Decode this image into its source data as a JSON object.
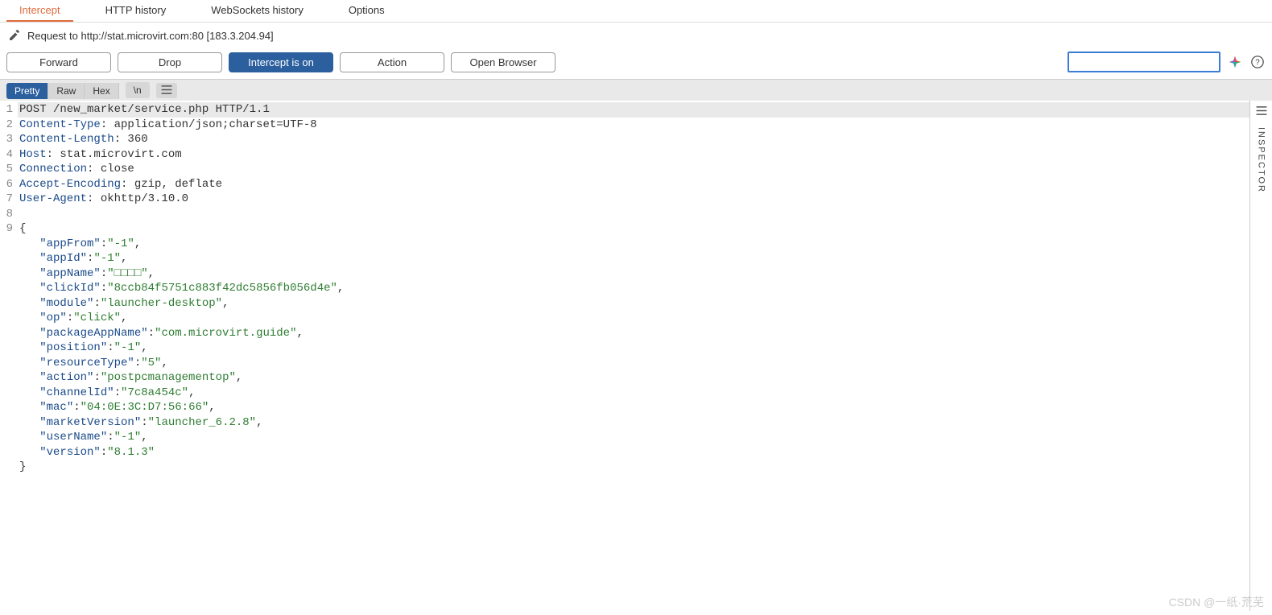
{
  "tabs": [
    "Intercept",
    "HTTP history",
    "WebSockets history",
    "Options"
  ],
  "activeTab": 0,
  "requestLine": "Request to http://stat.microvirt.com:80  [183.3.204.94]",
  "buttons": {
    "forward": "Forward",
    "drop": "Drop",
    "intercept": "Intercept is on",
    "action": "Action",
    "open": "Open Browser"
  },
  "searchPlaceholder": "",
  "viewTabs": [
    "Pretty",
    "Raw",
    "Hex"
  ],
  "viewActive": 0,
  "nlButton": "\\n",
  "sidePanel": "INSPECTOR",
  "request": {
    "line": "POST /new_market/service.php HTTP/1.1",
    "headers": [
      {
        "k": "Content-Type",
        "v": "application/json;charset=UTF-8"
      },
      {
        "k": "Content-Length",
        "v": "360"
      },
      {
        "k": "Host",
        "v": "stat.microvirt.com"
      },
      {
        "k": "Connection",
        "v": "close"
      },
      {
        "k": "Accept-Encoding",
        "v": "gzip, deflate"
      },
      {
        "k": "User-Agent",
        "v": "okhttp/3.10.0"
      }
    ],
    "bodyPairs": [
      {
        "k": "appFrom",
        "v": "-1",
        "c": true
      },
      {
        "k": "appId",
        "v": "-1",
        "c": true
      },
      {
        "k": "appName",
        "v": "□□□□",
        "c": true
      },
      {
        "k": "clickId",
        "v": "8ccb84f5751c883f42dc5856fb056d4e",
        "c": true
      },
      {
        "k": "module",
        "v": "launcher-desktop",
        "c": true
      },
      {
        "k": "op",
        "v": "click",
        "c": true
      },
      {
        "k": "packageAppName",
        "v": "com.microvirt.guide",
        "c": true
      },
      {
        "k": "position",
        "v": "-1",
        "c": true
      },
      {
        "k": "resourceType",
        "v": "5",
        "c": true
      },
      {
        "k": "action",
        "v": "postpcmanagementop",
        "c": true
      },
      {
        "k": "channelId",
        "v": "7c8a454c",
        "c": true
      },
      {
        "k": "mac",
        "v": "04:0E:3C:D7:56:66",
        "c": true
      },
      {
        "k": "marketVersion",
        "v": "launcher_6.2.8",
        "c": true
      },
      {
        "k": "userName",
        "v": "-1",
        "c": true
      },
      {
        "k": "version",
        "v": "8.1.3",
        "c": false
      }
    ]
  },
  "watermark": "CSDN @一纸·荒芜"
}
